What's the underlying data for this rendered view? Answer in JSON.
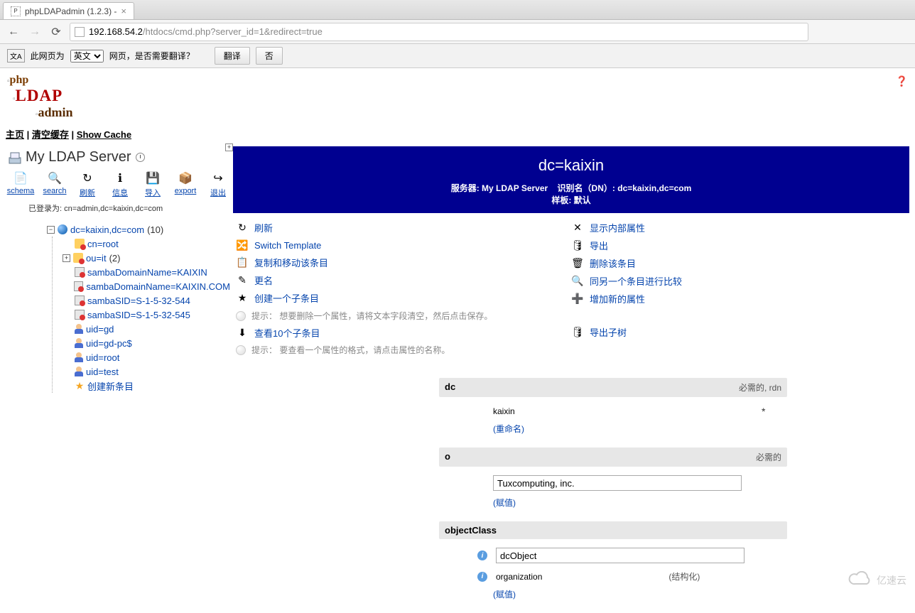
{
  "browser": {
    "tab_title": "phpLDAPadmin (1.2.3) -",
    "url_ip": "192.168.54.2",
    "url_path": "/htdocs/cmd.php?server_id=1&redirect=true"
  },
  "translate_bar": {
    "prefix": "此网页为",
    "lang_select": "英文",
    "suffix": "网页，是否需要翻译？",
    "btn_translate": "翻译",
    "btn_no": "否"
  },
  "top_links": {
    "home": "主页",
    "clear": "清空缓存",
    "show_cache": "Show Cache"
  },
  "server": {
    "title": "My LDAP Server",
    "login_line": "已登录为: cn=admin,dc=kaixin,dc=com"
  },
  "toolbar": [
    {
      "id": "schema",
      "label": "schema",
      "glyph": "📄"
    },
    {
      "id": "search",
      "label": "search",
      "glyph": "🔍"
    },
    {
      "id": "refresh",
      "label": "刷新",
      "glyph": "↻"
    },
    {
      "id": "info",
      "label": "信息",
      "glyph": "ℹ"
    },
    {
      "id": "import",
      "label": "导入",
      "glyph": "💾"
    },
    {
      "id": "export",
      "label": "export",
      "glyph": "📦"
    },
    {
      "id": "logout",
      "label": "退出",
      "glyph": "↪"
    }
  ],
  "tree": {
    "root": "dc=kaixin,dc=com",
    "root_count": "(10)",
    "nodes": [
      {
        "label": "cn=root",
        "icon": "grp"
      },
      {
        "label": "ou=it",
        "count": "(2)",
        "icon": "grp",
        "expandable": true
      },
      {
        "label": "sambaDomainName=KAIXIN",
        "icon": "host"
      },
      {
        "label": "sambaDomainName=KAIXIN.COM",
        "icon": "host"
      },
      {
        "label": "sambaSID=S-1-5-32-544",
        "icon": "host"
      },
      {
        "label": "sambaSID=S-1-5-32-545",
        "icon": "host"
      },
      {
        "label": "uid=gd",
        "icon": "user"
      },
      {
        "label": "uid=gd-pc$",
        "icon": "user"
      },
      {
        "label": "uid=root",
        "icon": "user"
      },
      {
        "label": "uid=test",
        "icon": "user"
      },
      {
        "label": "创建新条目",
        "icon": "star"
      }
    ]
  },
  "banner": {
    "title": "dc=kaixin",
    "server_lbl": "服务器:",
    "server_val": "My LDAP Server",
    "dn_lbl": "识别名（DN）:",
    "dn_val": "dc=kaixin,dc=com",
    "tpl_lbl": "样板:",
    "tpl_val": "默认"
  },
  "actions_left": [
    {
      "id": "refresh",
      "label": "刷新",
      "glyph": "↻"
    },
    {
      "id": "switch-template",
      "label": "Switch Template",
      "glyph": "🔀"
    },
    {
      "id": "copy-move",
      "label": "复制和移动该条目",
      "glyph": "📋"
    },
    {
      "id": "rename",
      "label": "更名",
      "glyph": "✎"
    },
    {
      "id": "create-child",
      "label": "创建一个子条目",
      "glyph": "★"
    }
  ],
  "actions_right": [
    {
      "id": "show-internal",
      "label": "显示内部属性",
      "glyph": "✕"
    },
    {
      "id": "export",
      "label": "导出",
      "glyph": "🛢"
    },
    {
      "id": "delete",
      "label": "删除该条目",
      "glyph": "🗑"
    },
    {
      "id": "compare",
      "label": "同另一个条目进行比较",
      "glyph": "🔍"
    },
    {
      "id": "add-attr",
      "label": "增加新的属性",
      "glyph": "➕"
    }
  ],
  "hint1": "提示：   想要删除一个属性，请将文本字段清空，然后点击保存。",
  "action_view_children": "查看10个子条目",
  "action_export_sub": "导出子树",
  "hint2": "提示：   要查看一个属性的格式，请点击属性的名称。",
  "attrs": {
    "dc": {
      "name": "dc",
      "meta": "必需的, rdn",
      "value": "kaixin",
      "sublink": "(重命名)",
      "star": "*"
    },
    "o": {
      "name": "o",
      "meta": "必需的",
      "value": "Tuxcomputing, inc.",
      "sublink": "(赋值)"
    },
    "objectClass": {
      "name": "objectClass",
      "v1": "dcObject",
      "v2": "organization",
      "side": "(结构化)",
      "sublink": "(赋值)"
    }
  },
  "watermark": "亿速云"
}
